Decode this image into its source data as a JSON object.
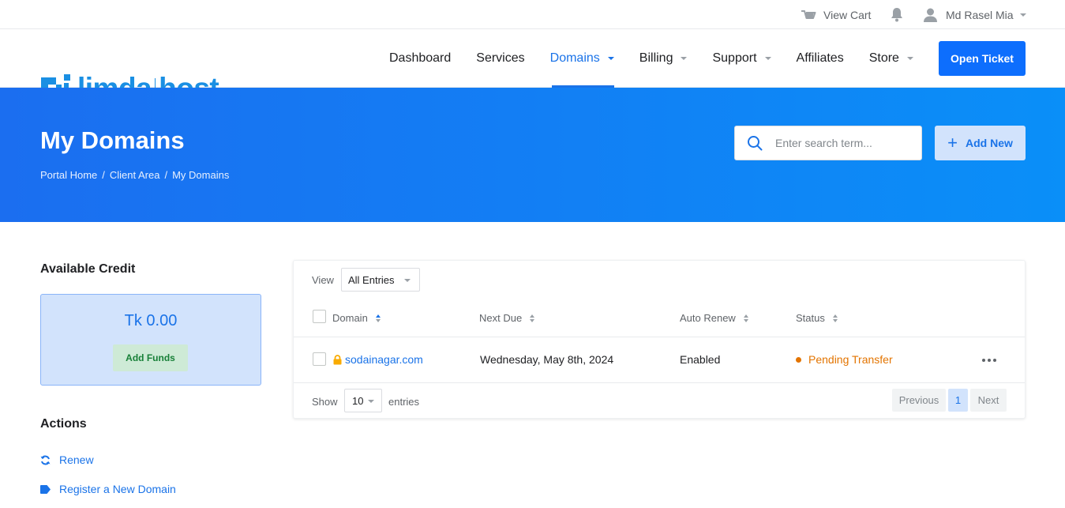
{
  "topbar": {
    "cart_label": "View Cart",
    "user_name": "Md Rasel Mia"
  },
  "logo": {
    "left": "limda",
    "right": "host"
  },
  "nav": {
    "items": [
      {
        "label": "Dashboard"
      },
      {
        "label": "Services"
      },
      {
        "label": "Domains"
      },
      {
        "label": "Billing"
      },
      {
        "label": "Support"
      },
      {
        "label": "Affiliates"
      },
      {
        "label": "Store"
      }
    ],
    "open_ticket": "Open Ticket"
  },
  "hero": {
    "title": "My Domains",
    "breadcrumb": [
      "Portal Home",
      "Client Area",
      "My Domains"
    ],
    "search_placeholder": "Enter search term...",
    "add_new": "Add New"
  },
  "sidebar": {
    "credit_title": "Available Credit",
    "credit_amount": "Tk 0.00",
    "add_funds": "Add Funds",
    "actions_title": "Actions",
    "actions": [
      {
        "label": "Renew",
        "icon": "renew-icon"
      },
      {
        "label": "Register a New Domain",
        "icon": "tag-icon"
      }
    ]
  },
  "table": {
    "view_label": "View",
    "view_value": "All Entries",
    "columns": [
      "Domain",
      "Next Due",
      "Auto Renew",
      "Status"
    ],
    "rows": [
      {
        "domain": "sodainagar.com",
        "next_due": "Wednesday, May 8th, 2024",
        "auto_renew": "Enabled",
        "status": "Pending Transfer"
      }
    ],
    "show_label": "Show",
    "page_length": "10",
    "entries_label": "entries",
    "pagination": {
      "previous": "Previous",
      "current": "1",
      "next": "Next"
    }
  },
  "colors": {
    "primary": "#1a73e8",
    "button_blue": "#0d6efd",
    "hero_start": "#1b6ef0",
    "hero_end": "#0a8ff8",
    "status_pending": "#e37400",
    "funds_green": "#188038"
  }
}
